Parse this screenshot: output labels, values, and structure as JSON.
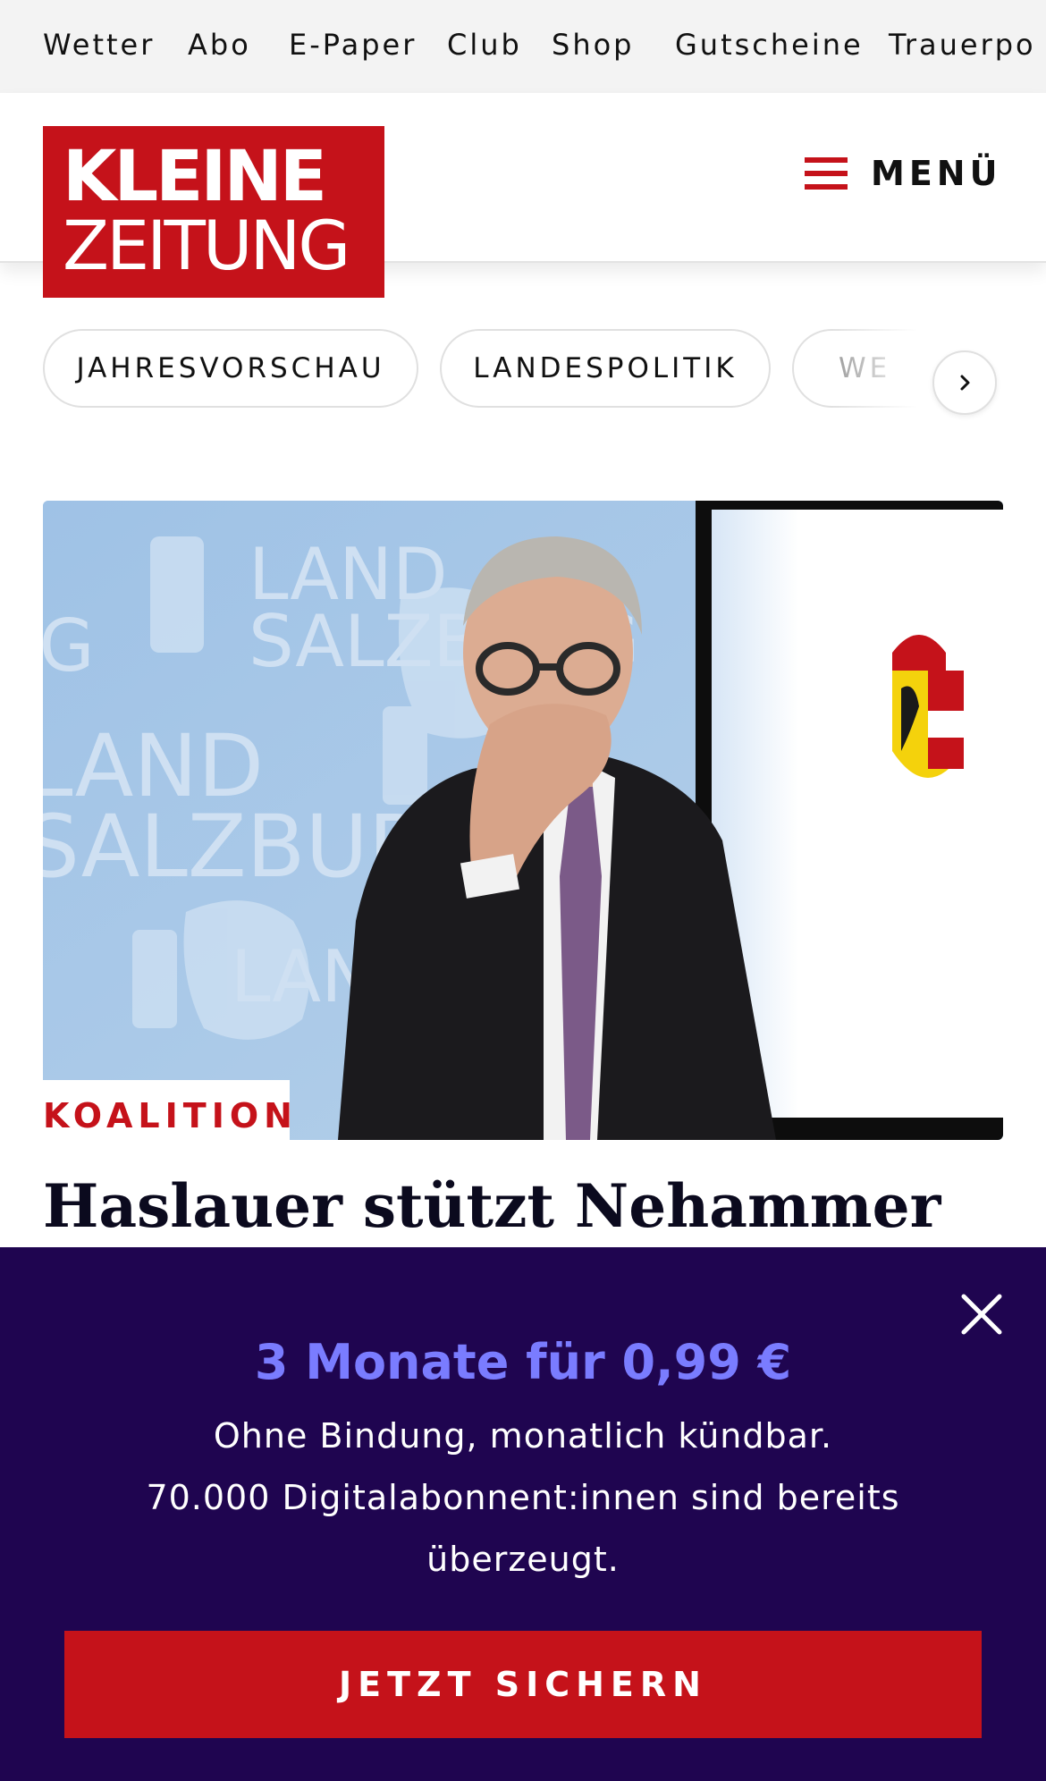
{
  "topnav": {
    "items": [
      "Wetter",
      "Abo",
      "E-Paper",
      "Club",
      "Shop",
      "Gutscheine",
      "Trauerpo"
    ]
  },
  "header": {
    "logo_line1": "KLEINE",
    "logo_line2": "ZEITUNG",
    "menu_label": "MENÜ"
  },
  "topics": {
    "chips": [
      "JAHRESVORSCHAU",
      "LANDESPOLITIK",
      "WE"
    ]
  },
  "article": {
    "hero_image": {
      "backdrop_text_1": "LAND",
      "backdrop_text_2": "SALZBURG"
    },
    "kicker": "KOALITION",
    "headline": "Haslauer stützt Nehammer"
  },
  "promo": {
    "title": "3 Monate für 0,99 €",
    "line1": "Ohne Bindung, monatlich kündbar.",
    "line2": "70.000 Digitalabonnent:innen sind bereits überzeugt.",
    "button_label": "JETZT SICHERN"
  },
  "colors": {
    "brand_red": "#c5121a",
    "promo_bg": "#1f0550",
    "promo_accent": "#7a7cff"
  }
}
